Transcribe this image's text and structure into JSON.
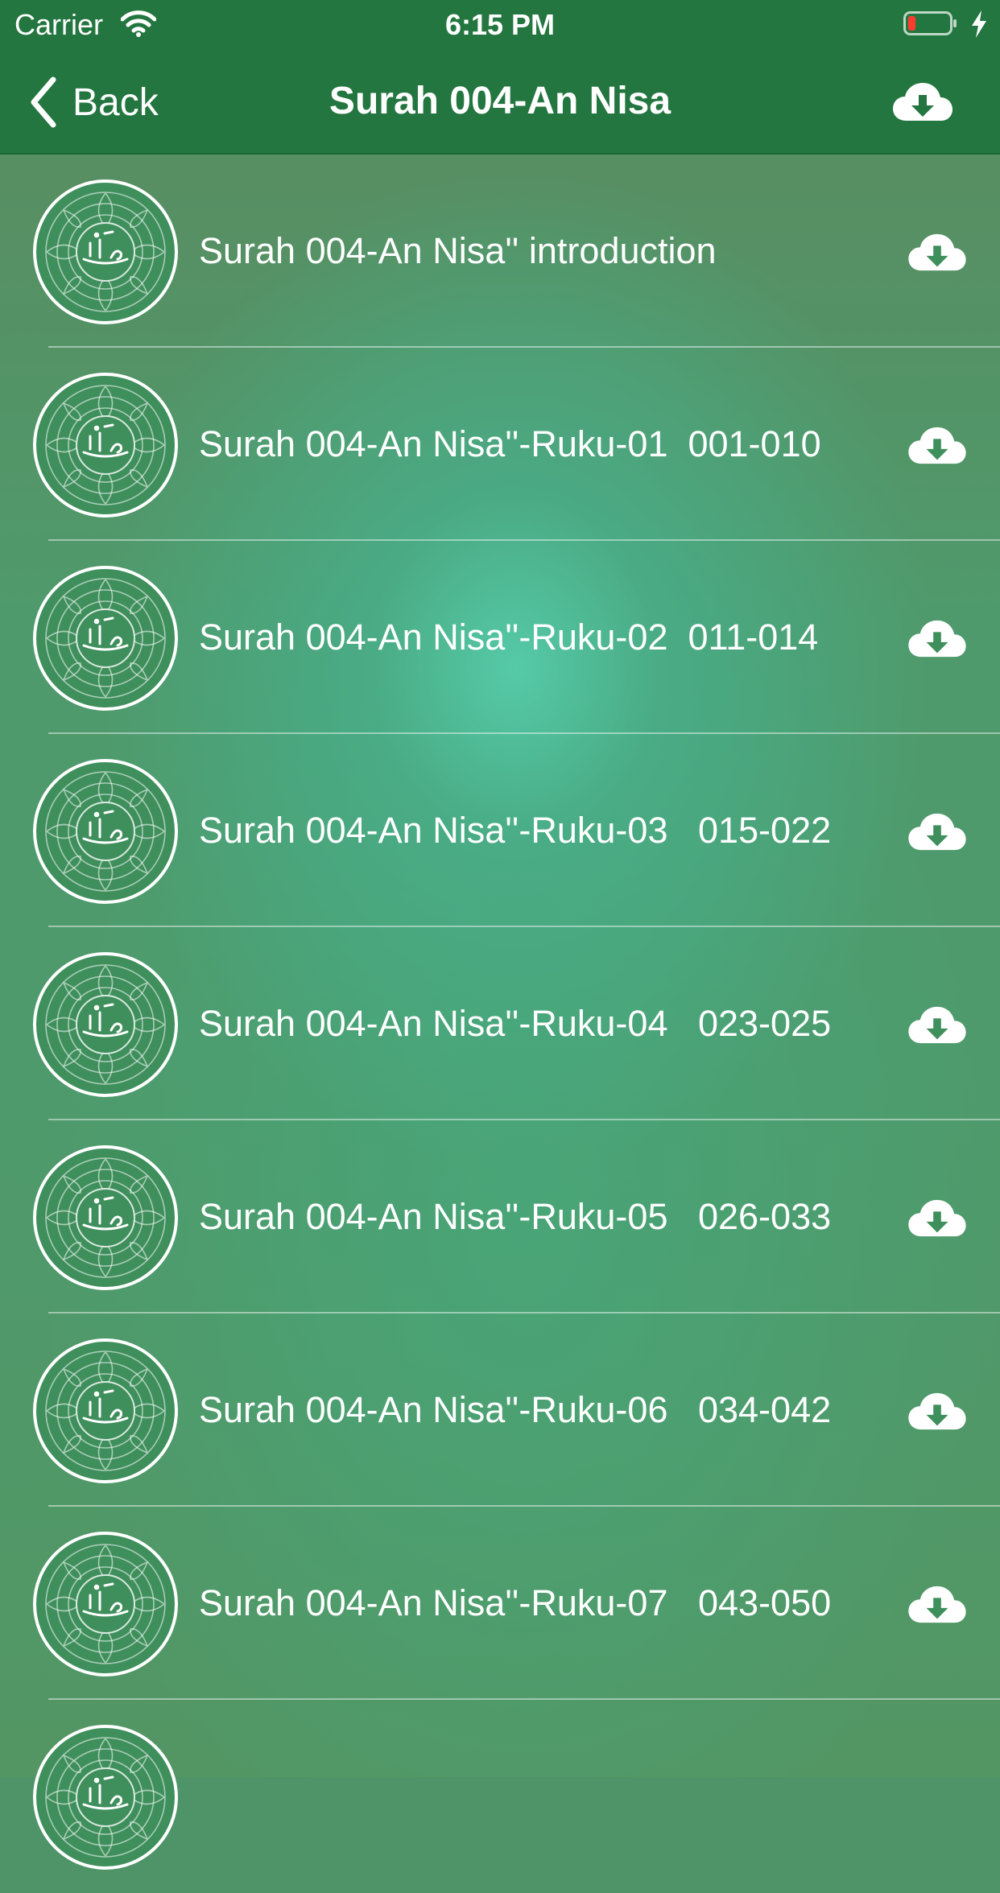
{
  "status_bar": {
    "carrier": "Carrier",
    "time": "6:15 PM",
    "battery_color": "#ff3b30"
  },
  "nav": {
    "back_label": "Back",
    "title": "Surah 004-An Nisa"
  },
  "colors": {
    "nav_background": "#23763f",
    "text": "#ffffff"
  },
  "list": {
    "items": [
      {
        "label": "Surah 004-An Nisa'' introduction"
      },
      {
        "label": "Surah 004-An Nisa''-Ruku-01  001-010"
      },
      {
        "label": "Surah 004-An Nisa''-Ruku-02  011-014"
      },
      {
        "label": "Surah 004-An Nisa''-Ruku-03   015-022"
      },
      {
        "label": "Surah 004-An Nisa''-Ruku-04   023-025"
      },
      {
        "label": "Surah 004-An Nisa''-Ruku-05   026-033"
      },
      {
        "label": "Surah 004-An Nisa''-Ruku-06   034-042"
      },
      {
        "label": "Surah 004-An Nisa''-Ruku-07   043-050"
      },
      {
        "label": ""
      }
    ]
  }
}
